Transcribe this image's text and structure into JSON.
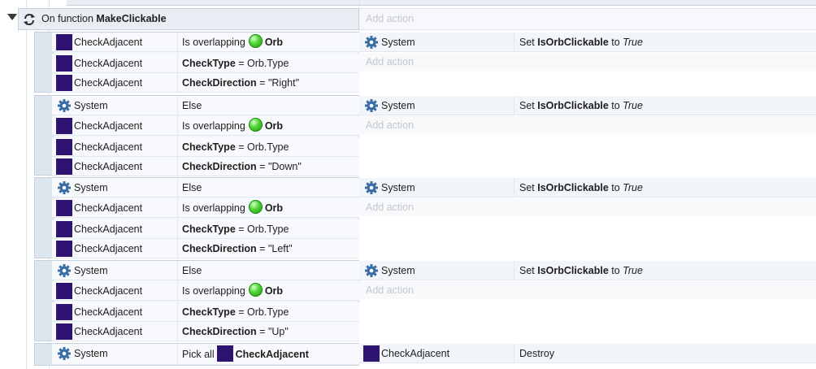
{
  "function": {
    "prefix": "On function",
    "name": "MakeClickable",
    "add_action": "Add action"
  },
  "blocks": [
    {
      "conditions": [
        {
          "object": "CheckAdjacent",
          "kind": "sprite",
          "text_a": "Is overlapping",
          "icon": "orb-icon",
          "text_b": "Orb"
        },
        {
          "object": "CheckAdjacent",
          "kind": "sprite",
          "text_a": "CheckType",
          "text_b": " = Orb.Type"
        },
        {
          "object": "CheckAdjacent",
          "kind": "sprite",
          "text_a": "CheckDirection",
          "text_b": " = \"Right\""
        }
      ],
      "action": {
        "object": "System",
        "prefix": "Set ",
        "var": "IsOrbClickable",
        "mid": " to ",
        "val": "True"
      },
      "add_action": "Add action"
    },
    {
      "conditions": [
        {
          "object": "System",
          "kind": "system",
          "text_a": "Else"
        },
        {
          "object": "CheckAdjacent",
          "kind": "sprite",
          "text_a": "Is overlapping",
          "icon": "orb-icon",
          "text_b": "Orb"
        },
        {
          "object": "CheckAdjacent",
          "kind": "sprite",
          "text_a": "CheckType",
          "text_b": " = Orb.Type"
        },
        {
          "object": "CheckAdjacent",
          "kind": "sprite",
          "text_a": "CheckDirection",
          "text_b": " = \"Down\""
        }
      ],
      "action": {
        "object": "System",
        "prefix": "Set ",
        "var": "IsOrbClickable",
        "mid": " to ",
        "val": "True"
      },
      "add_action": "Add action"
    },
    {
      "conditions": [
        {
          "object": "System",
          "kind": "system",
          "text_a": "Else"
        },
        {
          "object": "CheckAdjacent",
          "kind": "sprite",
          "text_a": "Is overlapping",
          "icon": "orb-icon",
          "text_b": "Orb"
        },
        {
          "object": "CheckAdjacent",
          "kind": "sprite",
          "text_a": "CheckType",
          "text_b": " = Orb.Type"
        },
        {
          "object": "CheckAdjacent",
          "kind": "sprite",
          "text_a": "CheckDirection",
          "text_b": " = \"Left\""
        }
      ],
      "action": {
        "object": "System",
        "prefix": "Set ",
        "var": "IsOrbClickable",
        "mid": " to ",
        "val": "True"
      },
      "add_action": "Add action"
    },
    {
      "conditions": [
        {
          "object": "System",
          "kind": "system",
          "text_a": "Else"
        },
        {
          "object": "CheckAdjacent",
          "kind": "sprite",
          "text_a": "Is overlapping",
          "icon": "orb-icon",
          "text_b": "Orb"
        },
        {
          "object": "CheckAdjacent",
          "kind": "sprite",
          "text_a": "CheckType",
          "text_b": " = Orb.Type"
        },
        {
          "object": "CheckAdjacent",
          "kind": "sprite",
          "text_a": "CheckDirection",
          "text_b": " = \"Up\""
        }
      ],
      "action": {
        "object": "System",
        "prefix": "Set ",
        "var": "IsOrbClickable",
        "mid": " to ",
        "val": "True"
      },
      "add_action": "Add action"
    },
    {
      "conditions": [
        {
          "object": "System",
          "kind": "system",
          "text_a": "Pick all",
          "icon": "checkadjacent-icon",
          "text_b": "CheckAdjacent"
        }
      ],
      "action": {
        "object": "CheckAdjacent",
        "kind": "sprite",
        "text": "Destroy"
      }
    }
  ]
}
